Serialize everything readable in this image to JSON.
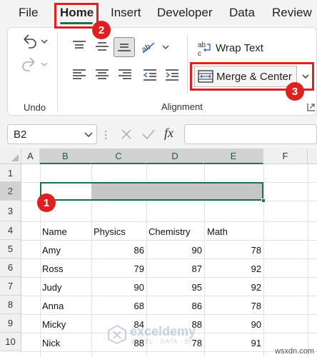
{
  "ribbon_tabs": [
    "File",
    "Home",
    "Insert",
    "Developer",
    "Data",
    "Review"
  ],
  "groups": {
    "undo_label": "Undo",
    "alignment_label": "Alignment"
  },
  "buttons": {
    "wrap_text": "Wrap Text",
    "merge_center": "Merge & Center"
  },
  "icons": [
    "undo-icon",
    "redo-icon",
    "align-top-icon",
    "align-middle-icon",
    "align-bottom-icon",
    "orientation-icon",
    "align-left-icon",
    "align-center-icon",
    "align-right-icon",
    "decrease-indent-icon",
    "increase-indent-icon",
    "wrap-text-icon",
    "merge-center-icon",
    "dialog-launcher-icon",
    "cancel-icon",
    "enter-icon",
    "function-icon"
  ],
  "formula_bar": {
    "name_box": "B2",
    "fx": "fx",
    "formula": ""
  },
  "sheet": {
    "columns": [
      "A",
      "B",
      "C",
      "D",
      "E",
      "F"
    ],
    "rows": [
      "1",
      "2",
      "3",
      "4",
      "5",
      "6",
      "7",
      "8",
      "9",
      "10"
    ],
    "headers": [
      "Name",
      "Physics",
      "Chemistry",
      "Math"
    ],
    "data": [
      [
        "Amy",
        "86",
        "90",
        "78"
      ],
      [
        "Ross",
        "79",
        "87",
        "92"
      ],
      [
        "Judy",
        "90",
        "95",
        "92"
      ],
      [
        "Anna",
        "68",
        "86",
        "78"
      ],
      [
        "Micky",
        "84",
        "88",
        "90"
      ],
      [
        "Nick",
        "88",
        "78",
        "91"
      ]
    ],
    "selected_range": "B2:E2"
  },
  "callouts": [
    "1",
    "2",
    "3"
  ],
  "watermark": {
    "name": "exceldemy",
    "sub": "EXCEL · DATA · BI"
  },
  "site_label": "wsxdn.com",
  "colors": {
    "accent_green": "#217346",
    "highlight_red": "#e02020",
    "selection_fill": "#c6c6c6"
  }
}
